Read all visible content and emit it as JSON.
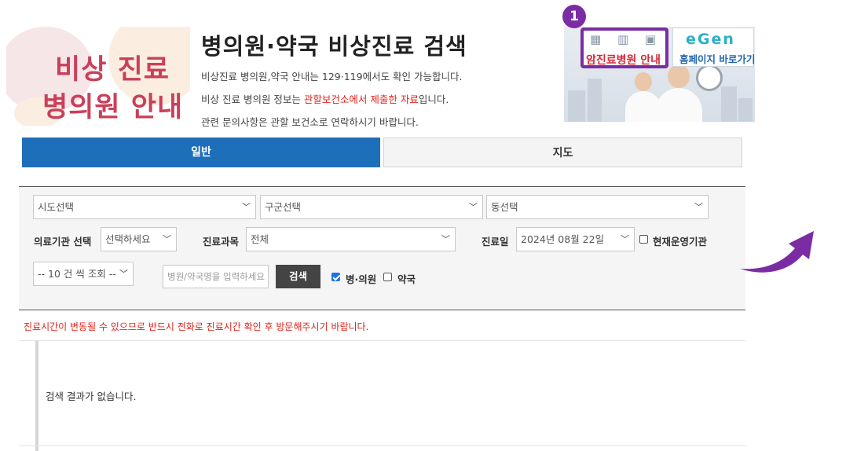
{
  "header": {
    "logo_line1": "비상 진료",
    "logo_line2": "병의원 안내",
    "title": "병의원·약국 비상진료 검색",
    "info1": "비상진료 병의원,약국 안내는 129·119에서도 확인 가능합니다.",
    "info2_pre": "비상 진료 병의원 정보는 ",
    "info2_highlight": "관할보건소에서 제출한 자료",
    "info2_post": "입니다.",
    "info3": "관련 문의사항은 관할 보건소로 연락하시기 바랍니다."
  },
  "banners": {
    "badge_number": "1",
    "cancer_hospital_label": "암진료병원 안내",
    "homepage_label": "홈페이지 바로가기"
  },
  "tabs": {
    "general": "일반",
    "map": "지도"
  },
  "search": {
    "sido": "시도선택",
    "gugun": "구군선택",
    "dong": "동선택",
    "institution_label": "의료기관 선택",
    "institution_value": "선택하세요",
    "department_label": "진료과목",
    "department_value": "전체",
    "date_label": "진료일",
    "date_value": "2024년 08월 22일",
    "currently_open_label": "현재운영기관",
    "currently_open_checked": false,
    "count_value": "-- 10 건 씩 조회 --",
    "name_placeholder": "병원/약국명을 입력하세요",
    "search_button": "검색",
    "hospital_label": "병·의원",
    "hospital_checked": true,
    "pharmacy_label": "약국",
    "pharmacy_checked": false
  },
  "notice": "진료시간이 변동될 수 있으므로 반드시 전화로 진료시간 확인 후 방문해주시기 바랍니다.",
  "results": {
    "empty_message": "검색 결과가 없습니다."
  },
  "colors": {
    "tab_active": "#1e6fba",
    "highlight_purple": "#7a2da3",
    "notice_red": "#e2231a",
    "logo_pink": "#c9405a"
  }
}
